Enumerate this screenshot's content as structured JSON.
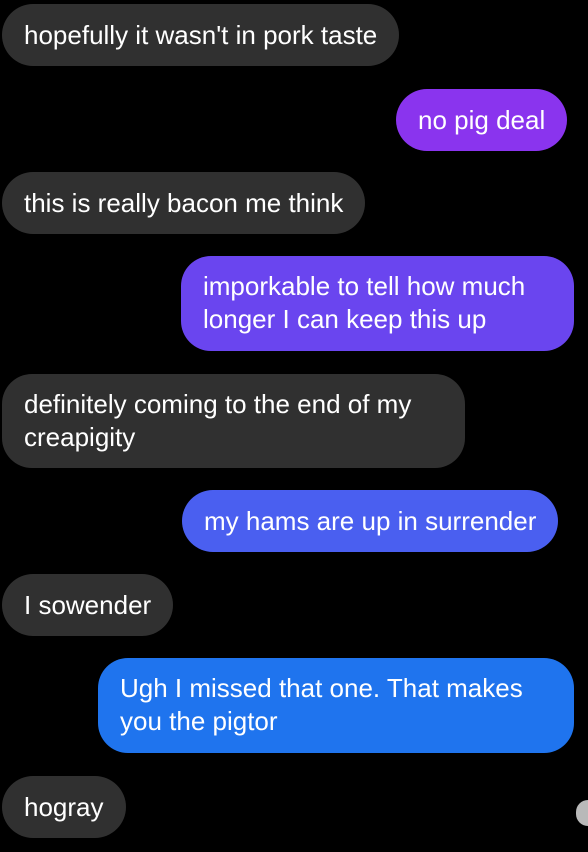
{
  "messages": [
    {
      "id": "m1",
      "direction": "received",
      "text": "hopefully it wasn't in pork taste",
      "color": "#303030"
    },
    {
      "id": "m2",
      "direction": "sent",
      "text": "no pig deal",
      "color": "#8a34ee"
    },
    {
      "id": "m3",
      "direction": "received",
      "text": "this is really bacon me think",
      "color": "#303030"
    },
    {
      "id": "m4",
      "direction": "sent",
      "text": "imporkable to tell how much longer I can keep this up",
      "color": "#6a45ef"
    },
    {
      "id": "m5",
      "direction": "received",
      "text": "definitely coming to the end of my creapigity",
      "color": "#303030"
    },
    {
      "id": "m6",
      "direction": "sent",
      "text": "my hams are up in surrender",
      "color": "#4a5ff0"
    },
    {
      "id": "m7",
      "direction": "received",
      "text": "I sowender",
      "color": "#303030"
    },
    {
      "id": "m8",
      "direction": "sent",
      "text": "Ugh I missed that one. That makes you the pigtor",
      "color": "#1f74ee"
    },
    {
      "id": "m9",
      "direction": "received",
      "text": "hogray",
      "color": "#303030"
    }
  ]
}
